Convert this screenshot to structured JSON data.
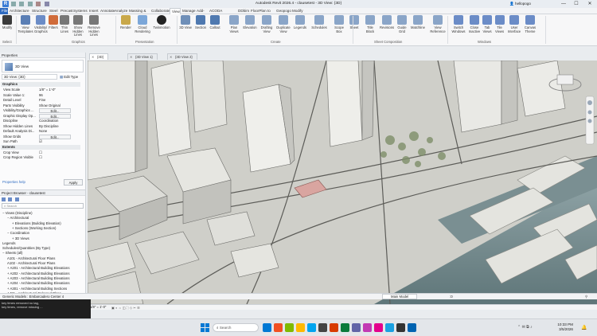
{
  "app": {
    "title": "Autodesk Revit 2026.4 - clausetest - 3D View: {3D}",
    "user": "hellopogo"
  },
  "menu": [
    "File",
    "Architecture",
    "Structure",
    "Steel",
    "Precast",
    "Systems",
    "Insert",
    "Annotate",
    "Analyze",
    "Massing & Site",
    "Collaborate",
    "View",
    "Manage",
    "Add-Ins",
    "ACODA Compliance",
    "DDbim",
    "FloorPlan to 3D",
    "Geopogo",
    "Modify"
  ],
  "ribbon": {
    "buttons": [
      {
        "label": "Modify",
        "color": "#3b3b3b"
      },
      {
        "label": "View Templates",
        "color": "#5b7fb5"
      },
      {
        "label": "Visibility/ Graphics",
        "color": "#6b8cc7"
      },
      {
        "label": "Filters",
        "color": "#d06b3a"
      },
      {
        "label": "Thin Lines",
        "color": "#777"
      },
      {
        "label": "Show Hidden Lines",
        "color": "#777"
      },
      {
        "label": "Remove Hidden Lines",
        "color": "#777"
      },
      {
        "label": "Render",
        "color": "#c9a84a"
      },
      {
        "label": "Cloud Rendering",
        "color": "#7ca7d9"
      },
      {
        "label": "Twinmotion",
        "color": "#222"
      },
      {
        "label": "3D View",
        "color": "#6f8fb8"
      },
      {
        "label": "Section",
        "color": "#4f79b0"
      },
      {
        "label": "Callout",
        "color": "#4f79b0"
      },
      {
        "label": "Plan Views",
        "color": "#8aa5c8"
      },
      {
        "label": "Elevation",
        "color": "#8aa5c8"
      },
      {
        "label": "Drafting View",
        "color": "#8aa5c8"
      },
      {
        "label": "Duplicate View",
        "color": "#8aa5c8"
      },
      {
        "label": "Legends",
        "color": "#8aa5c8"
      },
      {
        "label": "Schedules",
        "color": "#8aa5c8"
      },
      {
        "label": "Scope Box",
        "color": "#8aa5c8"
      },
      {
        "label": "Sheet",
        "color": "#8aa5c8"
      },
      {
        "label": "Title Block",
        "color": "#8aa5c8"
      },
      {
        "label": "Revisions",
        "color": "#8aa5c8"
      },
      {
        "label": "Guide Grid",
        "color": "#8aa5c8"
      },
      {
        "label": "Matchline",
        "color": "#8aa5c8"
      },
      {
        "label": "View Reference",
        "color": "#8aa5c8"
      },
      {
        "label": "Switch Windows",
        "color": "#6b8cc7"
      },
      {
        "label": "Close Inactive",
        "color": "#6b8cc7"
      },
      {
        "label": "Tab Views",
        "color": "#6b8cc7"
      },
      {
        "label": "Tile Views",
        "color": "#6b8cc7"
      },
      {
        "label": "User Interface",
        "color": "#6b8cc7"
      },
      {
        "label": "Canvas Theme",
        "color": "#6b8cc7"
      }
    ],
    "panels": [
      "Select",
      "Graphics",
      "Presentation",
      "Create",
      "Sheet Composition",
      "Windows"
    ]
  },
  "properties": {
    "title": "Properties",
    "type_label": "3D View",
    "selector": "3D View: {3D}",
    "edit_type": "Edit Type",
    "sections": [
      {
        "name": "Graphics",
        "rows": [
          {
            "key": "View Scale",
            "value": "1/8\" = 1'-0\""
          },
          {
            "key": "Scale Value 1:",
            "value": "96"
          },
          {
            "key": "Detail Level",
            "value": "Fine"
          },
          {
            "key": "Parts Visibility",
            "value": "Show Original"
          },
          {
            "key": "Visibility/Graphics ...",
            "value": "Edit..."
          },
          {
            "key": "Graphic Display Op...",
            "value": "Edit..."
          },
          {
            "key": "Discipline",
            "value": "Coordination"
          },
          {
            "key": "Show Hidden Lines",
            "value": "By Discipline"
          },
          {
            "key": "Default Analysis Di...",
            "value": "None"
          },
          {
            "key": "Show Grids",
            "value": "Edit..."
          },
          {
            "key": "Sun Path",
            "value": "☑"
          }
        ]
      },
      {
        "name": "Extents",
        "rows": [
          {
            "key": "Crop View",
            "value": "☐"
          },
          {
            "key": "Crop Region Visible",
            "value": "☐"
          }
        ]
      }
    ],
    "help_link": "Properties help",
    "apply": "Apply"
  },
  "browser": {
    "title": "Project Browser - clausetest",
    "search_placeholder": "Search",
    "items": [
      {
        "label": "Views (Discipline)",
        "indent": 0,
        "toggle": "−"
      },
      {
        "label": "Architectural",
        "indent": 1,
        "toggle": "−"
      },
      {
        "label": "Elevations (Building Elevation)",
        "indent": 2,
        "toggle": "+"
      },
      {
        "label": "Sections (Working Section)",
        "indent": 2,
        "toggle": "+"
      },
      {
        "label": "Coordination",
        "indent": 1,
        "toggle": "−"
      },
      {
        "label": "3D Views",
        "indent": 2,
        "toggle": "+"
      },
      {
        "label": "Legends",
        "indent": 0,
        "toggle": ""
      },
      {
        "label": "Schedules/Quantities (By Type)",
        "indent": 0,
        "toggle": ""
      },
      {
        "label": "Sheets (all)",
        "indent": 0,
        "toggle": "−"
      },
      {
        "label": "A101 - Architectural Floor Plans",
        "indent": 1,
        "toggle": ""
      },
      {
        "label": "A102 - Architectural Floor Plans",
        "indent": 1,
        "toggle": ""
      },
      {
        "label": "A201 - Architectural Building Elevations",
        "indent": 1,
        "toggle": "+"
      },
      {
        "label": "A202 - Architectural Building Elevations",
        "indent": 1,
        "toggle": "+"
      },
      {
        "label": "A203 - Architectural Building Elevations",
        "indent": 1,
        "toggle": "+"
      },
      {
        "label": "A204 - Architectural Building Elevations",
        "indent": 1,
        "toggle": "+"
      },
      {
        "label": "A301 - Architectural Building Sections",
        "indent": 1,
        "toggle": "+"
      },
      {
        "label": "A401 - Architectural Enlarged Plans",
        "indent": 1,
        "toggle": ""
      }
    ]
  },
  "tabs": [
    {
      "label": "{3D}",
      "active": true
    },
    {
      "label": "{3D View 1}",
      "active": false
    },
    {
      "label": "{3D View 2}",
      "active": false
    }
  ],
  "viewbar": {
    "scale": "1/8\" = 1'-0\""
  },
  "status": {
    "text": "Generic Models : Embarcadero Center 4",
    "model": "Main Model",
    "coords": ":0"
  },
  "command_popup": {
    "line1": "key times removed no tag, ",
    "line2": "key times, remove missing ..."
  },
  "taskbar": {
    "search_placeholder": "Search",
    "time": "10:33 PM",
    "date": "3/5/2026",
    "icon_colors": [
      "#0078d4",
      "#f25022",
      "#7fba00",
      "#ffb900",
      "#00a4ef",
      "#444",
      "#d83b01",
      "#0b7a3b",
      "#6264a7",
      "#c239b3",
      "#e3008c",
      "#1ba1e2",
      "#333",
      "#0063b1"
    ]
  }
}
